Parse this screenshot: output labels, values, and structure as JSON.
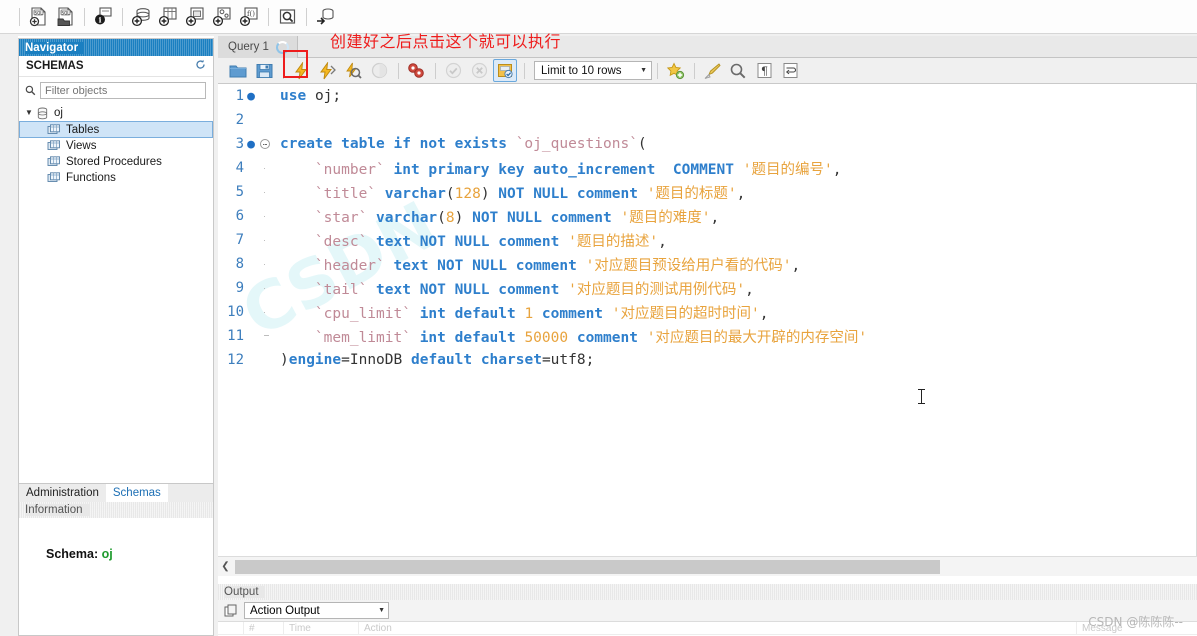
{
  "app_toolbar": {
    "icons": [
      {
        "name": "new-sql-tab-icon",
        "glyph": "SQL"
      },
      {
        "name": "open-sql-script-icon",
        "glyph": "SQL"
      },
      {
        "name": "connect-server-info-icon",
        "glyph": "i"
      },
      {
        "name": "new-schema-icon",
        "glyph": "db"
      },
      {
        "name": "new-table-icon",
        "glyph": "tbl"
      },
      {
        "name": "new-view-icon",
        "glyph": "view"
      },
      {
        "name": "new-procedure-icon",
        "glyph": "proc"
      },
      {
        "name": "new-function-icon",
        "glyph": "func"
      },
      {
        "name": "search-objects-icon",
        "glyph": "find"
      },
      {
        "name": "reconnect-server-icon",
        "glyph": "reconn"
      }
    ]
  },
  "navigator": {
    "title": "Navigator",
    "schemas_label": "SCHEMAS",
    "refresh_icon": "refresh-icon",
    "filter": {
      "placeholder": "Filter objects",
      "value": "",
      "icon": "search-icon"
    },
    "tree": [
      {
        "label": "oj",
        "level": 0,
        "icon": "schema-icon",
        "expanded": true,
        "selected": false
      },
      {
        "label": "Tables",
        "level": 1,
        "icon": "folder-icon",
        "expanded": false,
        "selected": true
      },
      {
        "label": "Views",
        "level": 1,
        "icon": "folder-icon",
        "expanded": false,
        "selected": false
      },
      {
        "label": "Stored Procedures",
        "level": 1,
        "icon": "folder-icon",
        "expanded": false,
        "selected": false
      },
      {
        "label": "Functions",
        "level": 1,
        "icon": "folder-icon",
        "expanded": false,
        "selected": false
      }
    ],
    "bottom_tabs": [
      {
        "label": "Administration",
        "active": false
      },
      {
        "label": "Schemas",
        "active": true
      }
    ]
  },
  "information": {
    "title": "Information",
    "schema_label": "Schema:",
    "schema_value": "oj"
  },
  "editor_tab": {
    "label": "Query 1",
    "spinner_icon": "loading-spinner-icon"
  },
  "sql_toolbar": {
    "icons": [
      {
        "name": "open-script-icon",
        "state": "normal"
      },
      {
        "name": "save-script-icon",
        "state": "normal"
      },
      {
        "name": "execute-statement-icon",
        "state": "normal"
      },
      {
        "name": "execute-current-statement-icon",
        "state": "normal"
      },
      {
        "name": "explain-query-icon",
        "state": "normal"
      },
      {
        "name": "stop-execution-icon",
        "state": "disabled"
      },
      {
        "name": "toggle-stop-on-error-icon",
        "state": "normal"
      },
      {
        "name": "commit-transaction-icon",
        "state": "disabled"
      },
      {
        "name": "rollback-transaction-icon",
        "state": "disabled"
      },
      {
        "name": "toggle-autocommit-icon",
        "state": "active"
      }
    ],
    "limit_dropdown": {
      "label": "Limit to 10 rows",
      "caret_icon": "chevron-down-icon"
    },
    "right_icons": [
      {
        "name": "save-snippet-icon"
      },
      {
        "name": "beautify-query-icon"
      },
      {
        "name": "find-replace-icon"
      },
      {
        "name": "toggle-invisible-chars-icon"
      },
      {
        "name": "toggle-word-wrap-icon"
      }
    ]
  },
  "annotation": {
    "text": "创建好之后点击这个就可以执行",
    "color": "#ee1c1c"
  },
  "editor": {
    "watermark": "CSDN",
    "lines": [
      {
        "num": "1",
        "dot": true,
        "fold": "none",
        "tokens": [
          {
            "t": "use",
            "c": "kw"
          },
          {
            "t": " ",
            "c": "plain"
          },
          {
            "t": "oj",
            "c": "plain"
          },
          {
            "t": ";",
            "c": "punc"
          }
        ]
      },
      {
        "num": "2",
        "dot": false,
        "fold": "none",
        "tokens": []
      },
      {
        "num": "3",
        "dot": true,
        "fold": "start",
        "tokens": [
          {
            "t": "create table if not exists ",
            "c": "kw"
          },
          {
            "t": "`oj_questions`",
            "c": "id"
          },
          {
            "t": "(",
            "c": "punc"
          }
        ]
      },
      {
        "num": "4",
        "dot": false,
        "fold": "mid",
        "tokens": [
          {
            "t": "    ",
            "c": "plain"
          },
          {
            "t": "`number`",
            "c": "id"
          },
          {
            "t": " ",
            "c": "plain"
          },
          {
            "t": "int primary key auto_increment",
            "c": "kw"
          },
          {
            "t": "  ",
            "c": "plain"
          },
          {
            "t": "COMMENT",
            "c": "kw"
          },
          {
            "t": " ",
            "c": "plain"
          },
          {
            "t": "'题目的编号'",
            "c": "str"
          },
          {
            "t": ",",
            "c": "punc"
          }
        ]
      },
      {
        "num": "5",
        "dot": false,
        "fold": "mid",
        "tokens": [
          {
            "t": "    ",
            "c": "plain"
          },
          {
            "t": "`title`",
            "c": "id"
          },
          {
            "t": " ",
            "c": "plain"
          },
          {
            "t": "varchar",
            "c": "kw"
          },
          {
            "t": "(",
            "c": "punc"
          },
          {
            "t": "128",
            "c": "num"
          },
          {
            "t": ") ",
            "c": "punc"
          },
          {
            "t": "NOT NULL comment",
            "c": "kw"
          },
          {
            "t": " ",
            "c": "plain"
          },
          {
            "t": "'题目的标题'",
            "c": "str"
          },
          {
            "t": ",",
            "c": "punc"
          }
        ]
      },
      {
        "num": "6",
        "dot": false,
        "fold": "mid",
        "tokens": [
          {
            "t": "    ",
            "c": "plain"
          },
          {
            "t": "`star`",
            "c": "id"
          },
          {
            "t": " ",
            "c": "plain"
          },
          {
            "t": "varchar",
            "c": "kw"
          },
          {
            "t": "(",
            "c": "punc"
          },
          {
            "t": "8",
            "c": "num"
          },
          {
            "t": ") ",
            "c": "punc"
          },
          {
            "t": "NOT NULL comment",
            "c": "kw"
          },
          {
            "t": " ",
            "c": "plain"
          },
          {
            "t": "'题目的难度'",
            "c": "str"
          },
          {
            "t": ",",
            "c": "punc"
          }
        ]
      },
      {
        "num": "7",
        "dot": false,
        "fold": "mid",
        "tokens": [
          {
            "t": "    ",
            "c": "plain"
          },
          {
            "t": "`desc`",
            "c": "id"
          },
          {
            "t": " ",
            "c": "plain"
          },
          {
            "t": "text NOT NULL comment",
            "c": "kw"
          },
          {
            "t": " ",
            "c": "plain"
          },
          {
            "t": "'题目的描述'",
            "c": "str"
          },
          {
            "t": ",",
            "c": "punc"
          }
        ]
      },
      {
        "num": "8",
        "dot": false,
        "fold": "mid",
        "tokens": [
          {
            "t": "    ",
            "c": "plain"
          },
          {
            "t": "`header`",
            "c": "id"
          },
          {
            "t": " ",
            "c": "plain"
          },
          {
            "t": "text NOT NULL comment",
            "c": "kw"
          },
          {
            "t": " ",
            "c": "plain"
          },
          {
            "t": "'对应题目预设给用户看的代码'",
            "c": "str"
          },
          {
            "t": ",",
            "c": "punc"
          }
        ]
      },
      {
        "num": "9",
        "dot": false,
        "fold": "mid",
        "tokens": [
          {
            "t": "    ",
            "c": "plain"
          },
          {
            "t": "`tail`",
            "c": "id"
          },
          {
            "t": " ",
            "c": "plain"
          },
          {
            "t": "text NOT NULL comment",
            "c": "kw"
          },
          {
            "t": " ",
            "c": "plain"
          },
          {
            "t": "'对应题目的测试用例代码'",
            "c": "str"
          },
          {
            "t": ",",
            "c": "punc"
          }
        ]
      },
      {
        "num": "10",
        "dot": false,
        "fold": "mid",
        "tokens": [
          {
            "t": "    ",
            "c": "plain"
          },
          {
            "t": "`cpu_limit`",
            "c": "id"
          },
          {
            "t": " ",
            "c": "plain"
          },
          {
            "t": "int default",
            "c": "kw"
          },
          {
            "t": " ",
            "c": "plain"
          },
          {
            "t": "1",
            "c": "num"
          },
          {
            "t": " ",
            "c": "plain"
          },
          {
            "t": "comment",
            "c": "kw"
          },
          {
            "t": " ",
            "c": "plain"
          },
          {
            "t": "'对应题目的超时时间'",
            "c": "str"
          },
          {
            "t": ",",
            "c": "punc"
          }
        ]
      },
      {
        "num": "11",
        "dot": false,
        "fold": "end",
        "tokens": [
          {
            "t": "    ",
            "c": "plain"
          },
          {
            "t": "`mem_limit`",
            "c": "id"
          },
          {
            "t": " ",
            "c": "plain"
          },
          {
            "t": "int default",
            "c": "kw"
          },
          {
            "t": " ",
            "c": "plain"
          },
          {
            "t": "50000",
            "c": "num"
          },
          {
            "t": " ",
            "c": "plain"
          },
          {
            "t": "comment",
            "c": "kw"
          },
          {
            "t": " ",
            "c": "plain"
          },
          {
            "t": "'对应题目的最大开辟的内存空间'",
            "c": "str"
          }
        ]
      },
      {
        "num": "12",
        "dot": false,
        "fold": "none",
        "tokens": [
          {
            "t": ")",
            "c": "punc"
          },
          {
            "t": "engine",
            "c": "kw"
          },
          {
            "t": "=",
            "c": "punc"
          },
          {
            "t": "InnoDB",
            "c": "plain"
          },
          {
            "t": " ",
            "c": "plain"
          },
          {
            "t": "default charset",
            "c": "kw"
          },
          {
            "t": "=",
            "c": "punc"
          },
          {
            "t": "utf8",
            "c": "plain"
          },
          {
            "t": ";",
            "c": "punc"
          }
        ]
      }
    ]
  },
  "scrollbar": {
    "left_arrow_icon": "chevron-left-icon"
  },
  "output": {
    "title": "Output",
    "view_dropdown": {
      "label": "Action Output",
      "icon": "output-pane-icon",
      "caret_icon": "chevron-down-icon"
    },
    "grid_columns": [
      "",
      "#",
      "Time",
      "Action",
      "Message"
    ]
  },
  "watermark": {
    "text": "CSDN @陈陈陈--"
  }
}
